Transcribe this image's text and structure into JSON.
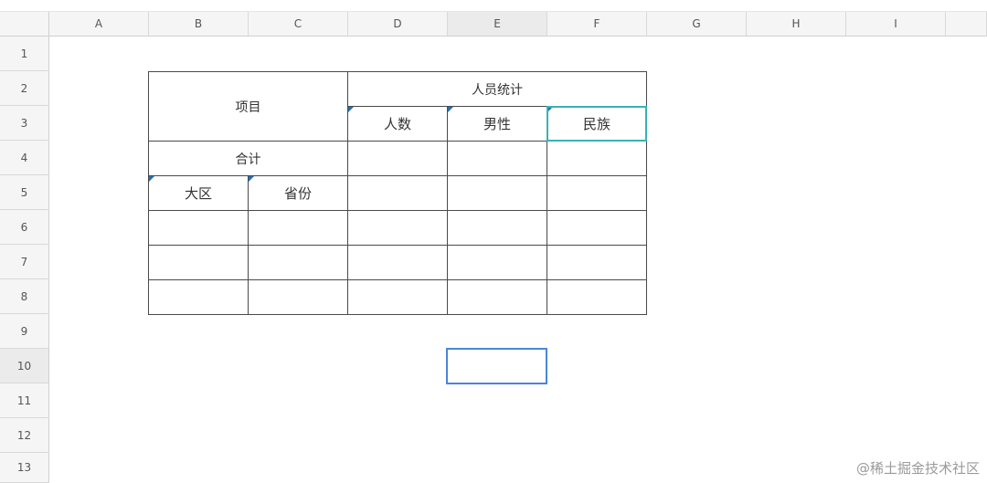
{
  "columns": [
    "A",
    "B",
    "C",
    "D",
    "E",
    "F",
    "G",
    "H",
    "I"
  ],
  "rows": [
    "1",
    "2",
    "3",
    "4",
    "5",
    "6",
    "7",
    "8",
    "9",
    "10",
    "11",
    "12",
    "13"
  ],
  "selected_column": "E",
  "selected_row": "10",
  "table": {
    "xiangmu": "项目",
    "renyuan_tongji": "人员统计",
    "renshu": "人数",
    "nanxing": "男性",
    "minzu": "民族",
    "heji": "合计",
    "daqu": "大区",
    "shengfen": "省份"
  },
  "watermark": "@稀土掘金技术社区",
  "colors": {
    "selection": "#4a86d9",
    "active_cell": "#36b3b6",
    "comment_marker": "#1f6fb8"
  }
}
